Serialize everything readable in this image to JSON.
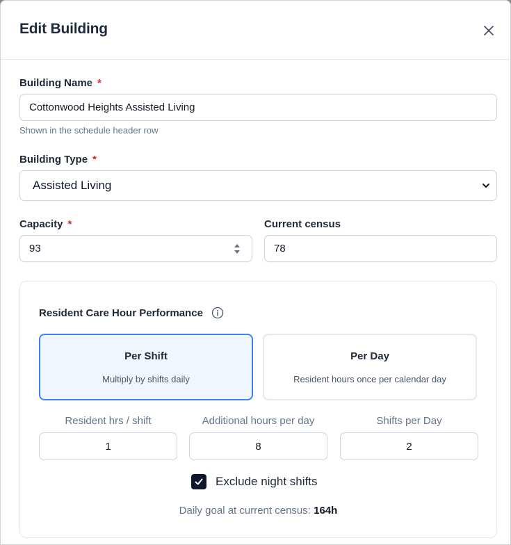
{
  "dialog": {
    "title": "Edit Building"
  },
  "building_name": {
    "label": "Building Name",
    "required_mark": "*",
    "value": "Cottonwood Heights Assisted Living",
    "hint": "Shown in the schedule header row"
  },
  "building_type": {
    "label": "Building Type",
    "required_mark": "*",
    "selected": "Assisted Living"
  },
  "capacity": {
    "label": "Capacity",
    "required_mark": "*",
    "value": "93"
  },
  "current_census": {
    "label": "Current census",
    "value": "78"
  },
  "performance": {
    "title": "Resident Care Hour Performance",
    "options": [
      {
        "title": "Per Shift",
        "description": "Multiply by shifts daily",
        "selected": true
      },
      {
        "title": "Per Day",
        "description": "Resident hours once per calendar day",
        "selected": false
      }
    ],
    "fields": [
      {
        "label": "Resident hrs / shift",
        "value": "1"
      },
      {
        "label": "Additional hours per day",
        "value": "8"
      },
      {
        "label": "Shifts per Day",
        "value": "2"
      }
    ],
    "exclude_night": {
      "label": "Exclude night shifts",
      "checked": true
    },
    "goal": {
      "prefix": "Daily goal at current census:",
      "value": "164h"
    }
  },
  "colors": {
    "accent": "#3b82f6",
    "selected_bg": "#eff6ff",
    "required": "#dc2626",
    "checkbox": "#0f172a"
  }
}
